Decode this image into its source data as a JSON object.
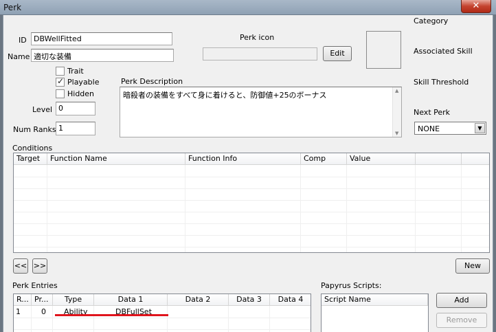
{
  "window": {
    "title": "Perk",
    "close_glyph": "✕"
  },
  "fields": {
    "id_label": "ID",
    "id_value": "DBWellFitted",
    "name_label": "Name",
    "name_value": "適切な装備",
    "level_label": "Level",
    "level_value": "0",
    "num_ranks_label": "Num Ranks",
    "num_ranks_value": "1"
  },
  "flags": [
    {
      "label": "Trait",
      "checked": false
    },
    {
      "label": "Playable",
      "checked": true
    },
    {
      "label": "Hidden",
      "checked": false
    }
  ],
  "perk_icon": {
    "label": "Perk icon",
    "path_value": "",
    "edit_label": "Edit"
  },
  "description": {
    "label": "Perk Description",
    "text": "暗殺者の装備をすべて身に着けると、防御値+25のボーナス"
  },
  "right_panel": {
    "category_label": "Category",
    "associated_skill_label": "Associated Skill",
    "skill_threshold_label": "Skill Threshold",
    "next_perk_label": "Next Perk",
    "next_perk_value": "NONE"
  },
  "conditions": {
    "label": "Conditions",
    "columns": [
      "Target",
      "Function Name",
      "Function Info",
      "Comp",
      "Value",
      ""
    ],
    "prev_label": "<<",
    "next_label": ">>",
    "new_label": "New"
  },
  "perk_entries": {
    "label": "Perk Entries",
    "columns": [
      "R...",
      "Pr...",
      "Type",
      "Data 1",
      "Data 2",
      "Data 3",
      "Data 4"
    ],
    "rows": [
      {
        "rank": "1",
        "priority": "0",
        "type": "Ability",
        "data1": "DBFullSet",
        "data2": "",
        "data3": "",
        "data4": ""
      }
    ],
    "underline_color": "#e0141c"
  },
  "papyrus": {
    "label": "Papyrus Scripts:",
    "column": "Script Name",
    "add_label": "Add",
    "remove_label": "Remove"
  }
}
